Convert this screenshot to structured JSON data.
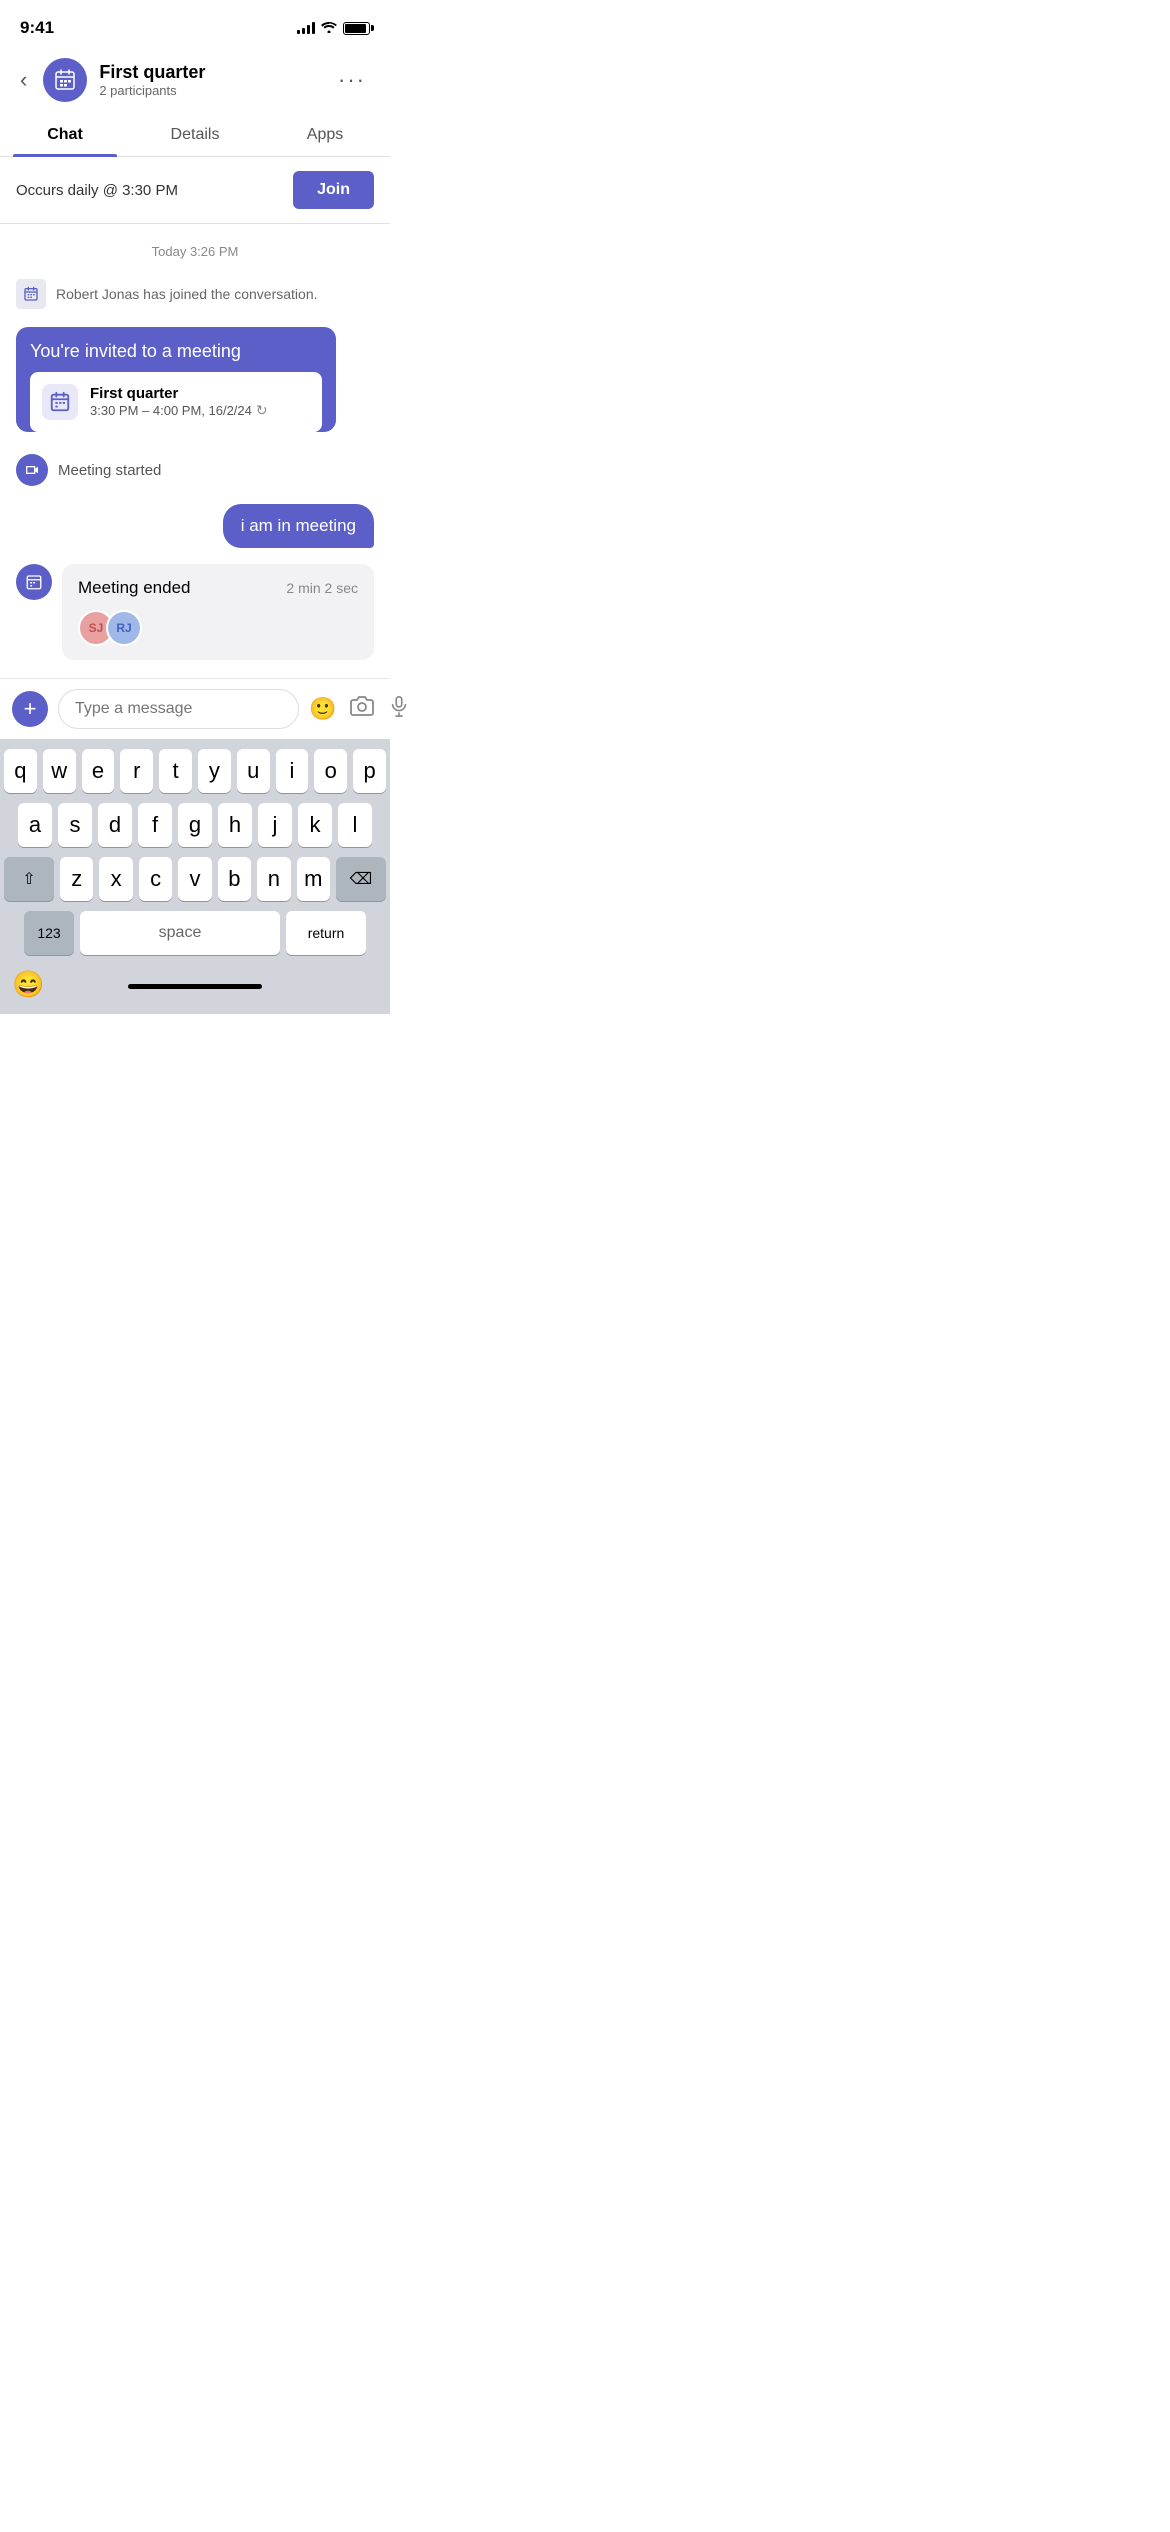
{
  "statusBar": {
    "time": "9:41",
    "batteryLabel": "battery"
  },
  "header": {
    "backLabel": "‹",
    "title": "First quarter",
    "subtitle": "2 participants",
    "moreLabel": "···"
  },
  "tabs": [
    {
      "label": "Chat",
      "active": true
    },
    {
      "label": "Details",
      "active": false
    },
    {
      "label": "Apps",
      "active": false
    }
  ],
  "joinBanner": {
    "text": "Occurs daily @ 3:30 PM",
    "buttonLabel": "Join"
  },
  "chat": {
    "dateSeparator": "Today  3:26 PM",
    "systemMessage": "Robert Jonas has joined the conversation.",
    "inviteCard": {
      "title": "You're invited to a meeting",
      "meetingName": "First quarter",
      "meetingTime": "3:30 PM – 4:00 PM, 16/2/24"
    },
    "meetingStarted": "Meeting started",
    "outgoingMessage": "i am in meeting",
    "meetingEnded": {
      "label": "Meeting ended",
      "duration": "2 min 2 sec",
      "participants": [
        {
          "initials": "SJ"
        },
        {
          "initials": "RJ"
        }
      ]
    }
  },
  "inputArea": {
    "placeholder": "Type a message",
    "addLabel": "+",
    "emojiLabel": "🙂",
    "cameraLabel": "📷",
    "micLabel": "🎤"
  },
  "keyboard": {
    "rows": [
      [
        "q",
        "w",
        "e",
        "r",
        "t",
        "y",
        "u",
        "i",
        "o",
        "p"
      ],
      [
        "a",
        "s",
        "d",
        "f",
        "g",
        "h",
        "j",
        "k",
        "l"
      ],
      [
        "z",
        "x",
        "c",
        "v",
        "b",
        "n",
        "m"
      ]
    ],
    "specialKeys": {
      "shift": "⇧",
      "delete": "⌫",
      "numbers": "123",
      "space": "space",
      "return": "return"
    },
    "bottomEmoji": "😄"
  }
}
